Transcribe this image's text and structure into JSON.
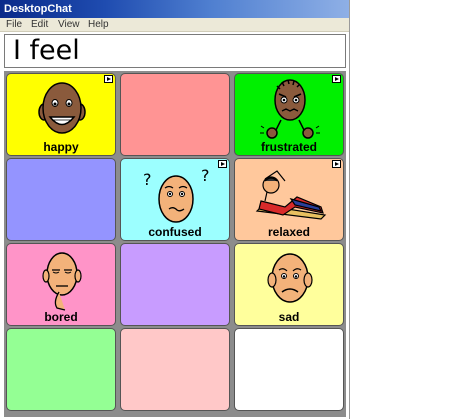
{
  "window": {
    "title": "DesktopChat"
  },
  "menubar": {
    "items": [
      "File",
      "Edit",
      "View",
      "Help"
    ]
  },
  "message": {
    "text": "I feel"
  },
  "grid": {
    "cells": [
      {
        "label": "happy",
        "color": "#ffff00",
        "icon": "happy-face-icon",
        "folder": true
      },
      {
        "label": "",
        "color": "#ff9494",
        "icon": "",
        "folder": false
      },
      {
        "label": "frustrated",
        "color": "#00f000",
        "icon": "frustrated-face-icon",
        "folder": true
      },
      {
        "label": "",
        "color": "#9494ff",
        "icon": "",
        "folder": false
      },
      {
        "label": "confused",
        "color": "#9cffff",
        "icon": "confused-face-icon",
        "folder": true
      },
      {
        "label": "relaxed",
        "color": "#ffc89c",
        "icon": "relaxed-person-icon",
        "folder": true
      },
      {
        "label": "bored",
        "color": "#ff94c8",
        "icon": "bored-face-icon",
        "folder": false
      },
      {
        "label": "",
        "color": "#c89cff",
        "icon": "",
        "folder": false
      },
      {
        "label": "sad",
        "color": "#ffff9c",
        "icon": "sad-face-icon",
        "folder": false
      },
      {
        "label": "",
        "color": "#94ff94",
        "icon": "",
        "folder": false
      },
      {
        "label": "",
        "color": "#ffc8c8",
        "icon": "",
        "folder": false
      },
      {
        "label": "",
        "color": "#ffffff",
        "icon": "",
        "folder": false
      }
    ]
  }
}
